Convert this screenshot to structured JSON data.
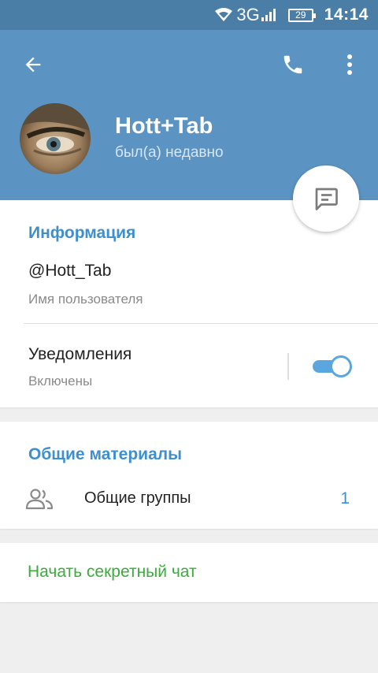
{
  "status_bar": {
    "network": "3G",
    "battery": "29",
    "time": "14:14"
  },
  "header": {
    "name": "Hott+Tab",
    "status": "был(а) недавно"
  },
  "info_section": {
    "title": "Информация",
    "username": "@Hott_Tab",
    "username_caption": "Имя пользователя",
    "notifications_label": "Уведомления",
    "notifications_state": "Включены",
    "notifications_enabled": true
  },
  "shared_section": {
    "title": "Общие материалы",
    "groups_label": "Общие группы",
    "groups_count": "1"
  },
  "secret_chat": {
    "label": "Начать секретный чат"
  },
  "colors": {
    "header_bg": "#5b93c2",
    "status_bar_bg": "#4a7ea6",
    "accent_blue": "#3d8fce",
    "secret_green": "#3bab3c"
  }
}
